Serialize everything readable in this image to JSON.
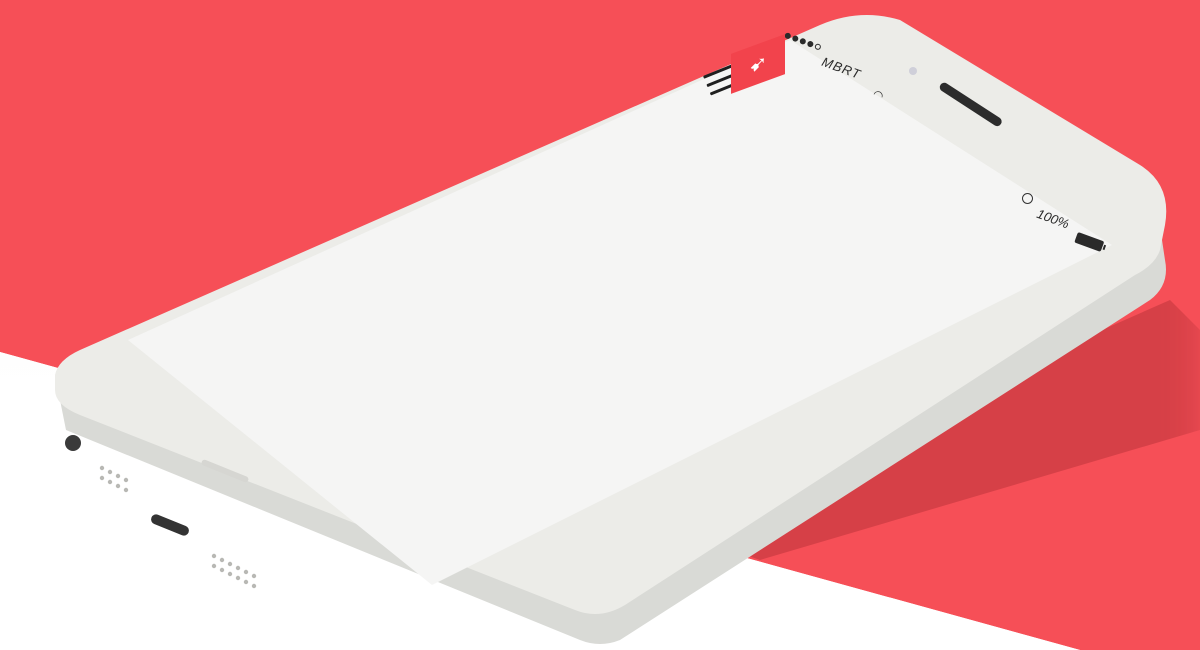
{
  "status_bar": {
    "carrier": "MBRT",
    "battery_percent": "100%",
    "signal_dots_filled": 4,
    "signal_dots_total": 5
  },
  "app": {
    "logo_icon": "winged-horse-logo-icon",
    "menu_icon": "hamburger-menu-icon"
  },
  "colors": {
    "background_accent": "#f64f57",
    "logo_tile": "#f2434c",
    "phone_body": "#ecece8",
    "screen": "#f5f5f4"
  }
}
